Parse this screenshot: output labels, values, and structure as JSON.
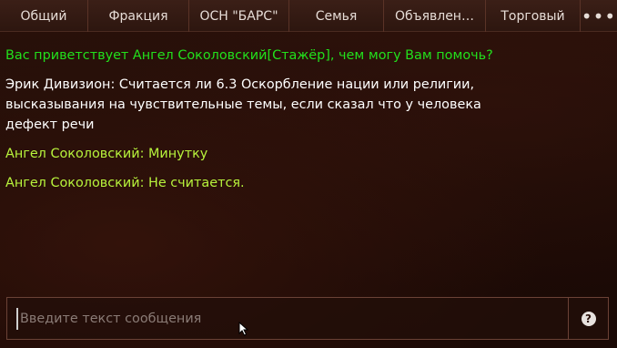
{
  "tabs": [
    {
      "label": "Общий"
    },
    {
      "label": "Фракция"
    },
    {
      "label": "ОСН \"БАРС\""
    },
    {
      "label": "Семья"
    },
    {
      "label": "Объявлен…"
    },
    {
      "label": "Торговый"
    }
  ],
  "more_label": "•••",
  "messages": [
    {
      "text": "Вас приветствует Ангел Соколовский[Стажёр], чем могу Вам помочь?"
    },
    {
      "text": "Эрик Дивизион: Считается ли 6.3 Оскорбление нации или религии, высказывания на чувствительные темы, если сказал что у человека дефект речи"
    },
    {
      "text": "Ангел Соколовский: Минутку"
    },
    {
      "text": "Ангел Соколовский: Не считается."
    }
  ],
  "input": {
    "placeholder": "Введите текст сообщения",
    "value": ""
  },
  "help_label": "?",
  "colors": {
    "system": "#22e01c",
    "player": "#ffffff",
    "staff": "#b8f43c"
  },
  "icons": {
    "more": "more-dots-icon",
    "help": "help-icon",
    "cursor": "mouse-cursor-icon"
  }
}
